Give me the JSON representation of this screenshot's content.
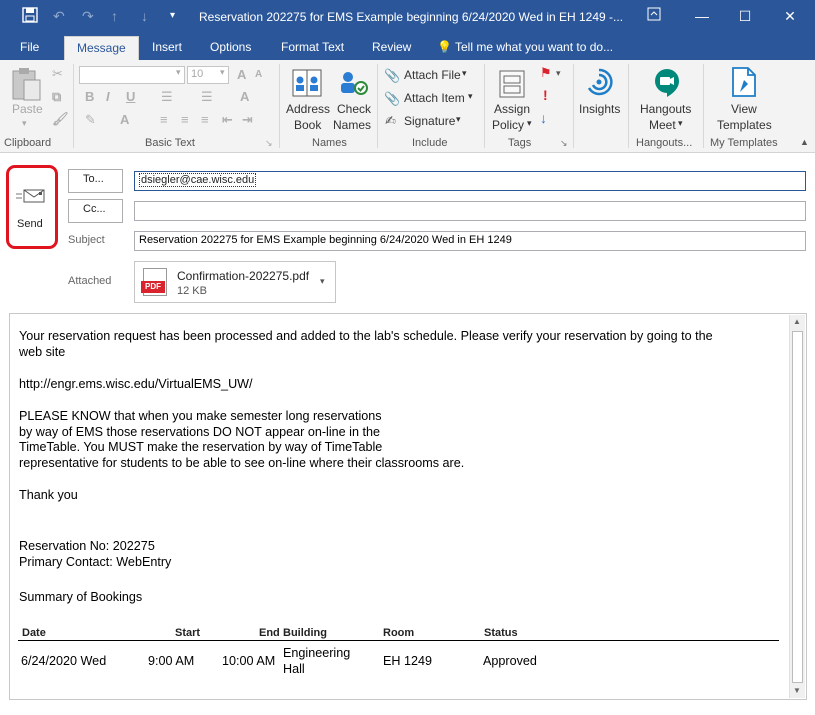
{
  "window": {
    "title": "Reservation 202275 for EMS Example beginning 6/24/2020 Wed in EH 1249 -..."
  },
  "tabs": [
    {
      "label": "File"
    },
    {
      "label": "Message"
    },
    {
      "label": "Insert"
    },
    {
      "label": "Options"
    },
    {
      "label": "Format Text"
    },
    {
      "label": "Review"
    }
  ],
  "tell_me": "Tell me what you want to do...",
  "ribbon": {
    "clipboard": {
      "paste": "Paste",
      "label": "Clipboard"
    },
    "basic_text": {
      "font_size": "10",
      "label": "Basic Text"
    },
    "names": {
      "address_book": "Address Book",
      "address_book_l1": "Address",
      "address_book_l2": "Book",
      "check_names_l1": "Check",
      "check_names_l2": "Names",
      "label": "Names"
    },
    "include": {
      "attach_file": "Attach File",
      "attach_item": "Attach Item",
      "signature": "Signature",
      "label": "Include"
    },
    "tags": {
      "assign_l1": "Assign",
      "assign_l2": "Policy",
      "label": "Tags"
    },
    "insights": {
      "label": "Insights"
    },
    "hangouts": {
      "l1": "Hangouts",
      "l2": "Meet",
      "label": "Hangouts..."
    },
    "templates": {
      "l1": "View",
      "l2": "Templates",
      "label": "My Templates"
    }
  },
  "header": {
    "send": "Send",
    "to_button": "To...",
    "cc_button": "Cc...",
    "to_value": "dsiegler@cae.wisc.edu",
    "cc_value": "",
    "subject_label": "Subject",
    "subject_value": "Reservation 202275 for EMS Example beginning 6/24/2020 Wed in EH 1249",
    "attached_label": "Attached",
    "attachment": {
      "name": "Confirmation-202275.pdf",
      "size": "12 KB",
      "icon": "PDF"
    }
  },
  "message": {
    "p1": "Your reservation request has been processed and added to the lab's schedule. Please verify your reservation by going to the",
    "p1b": "web site",
    "url": "http://engr.ems.wisc.edu/VirtualEMS_UW/",
    "p2a": "PLEASE KNOW that when you make semester long reservations",
    "p2b": "by way of EMS those reservations DO NOT appear on-line in the",
    "p2c": "TimeTable. You MUST make the reservation by way of TimeTable",
    "p2d": "representative for students to be able to see on-line where their classrooms are.",
    "thanks": "Thank you",
    "res_no": "Reservation No: 202275",
    "contact": "Primary Contact: WebEntry",
    "summary": "Summary of Bookings",
    "table": {
      "headers": {
        "date": "Date",
        "start": "Start",
        "end": "End",
        "building": "Building",
        "room": "Room",
        "status": "Status"
      },
      "row": {
        "date": "6/24/2020 Wed",
        "start": "9:00 AM",
        "end": "10:00 AM",
        "building_l1": "Engineering",
        "building_l2": "Hall",
        "room": "EH 1249",
        "status": "Approved"
      }
    }
  }
}
